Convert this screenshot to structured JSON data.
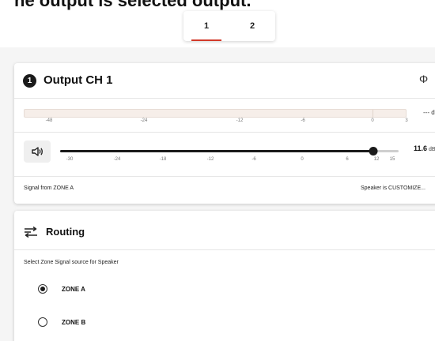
{
  "header": {
    "partial_text": "he output is selected output."
  },
  "channel_tabs": [
    {
      "label": "1",
      "active": true
    },
    {
      "label": "2",
      "active": false
    }
  ],
  "output_card": {
    "badge": "1",
    "title": "Output CH 1",
    "phase_icon": "phase-invert-icon",
    "phase_glyph": "Φ",
    "meter": {
      "readout": "--- dB",
      "scale": [
        "-48",
        "-24",
        "-12",
        "-6",
        "0",
        "3"
      ]
    },
    "volume": {
      "icon": "speaker-volume-icon",
      "value": "11.6",
      "unit": "dB",
      "min": -30,
      "max": 15,
      "current": 11.6,
      "scale": [
        "-30",
        "-24",
        "-18",
        "-12",
        "-6",
        "0",
        "6",
        "12",
        "15"
      ]
    },
    "signal_source": "Signal from ZONE A",
    "speaker_status": "Speaker is CUSTOMIZE..."
  },
  "routing_card": {
    "icon": "routing-icon",
    "title": "Routing",
    "subtitle": "Select Zone Signal source for Speaker",
    "options": [
      {
        "label": "ZONE A",
        "selected": true
      },
      {
        "label": "ZONE B",
        "selected": false
      }
    ]
  },
  "colors": {
    "accent_underline": "#d23a2a",
    "dark": "#1a1a1a",
    "meter_bg": "#f6eee9"
  }
}
